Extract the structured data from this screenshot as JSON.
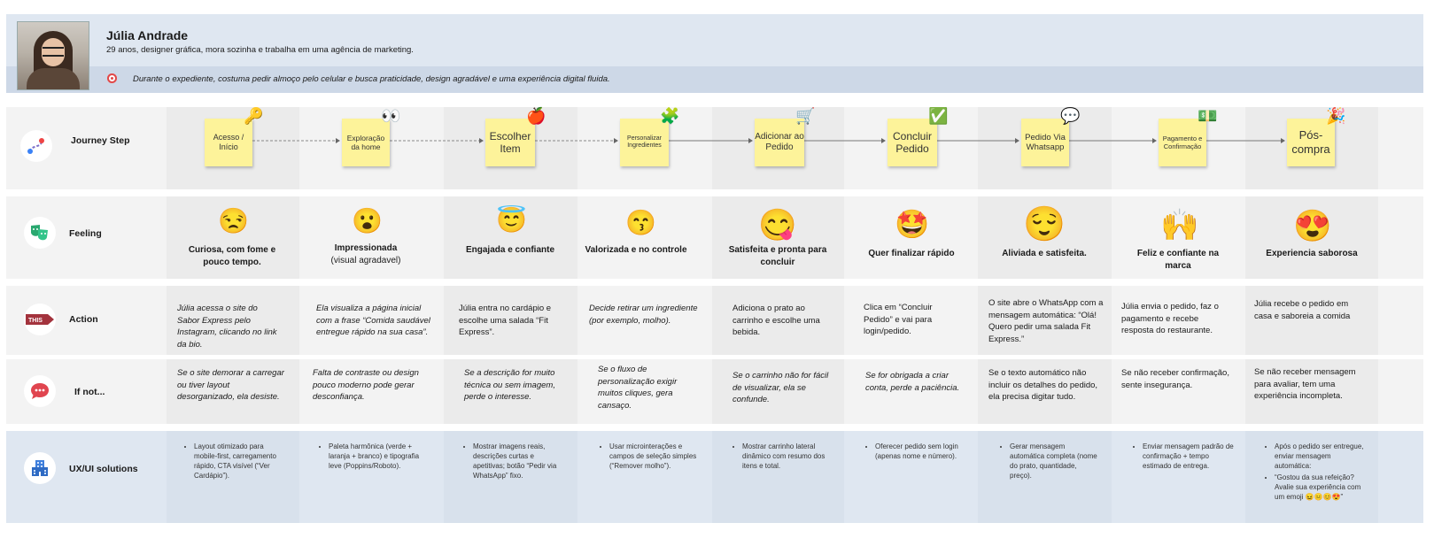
{
  "persona": {
    "name": "Júlia Andrade",
    "description": "29 anos, designer gráfica, mora sozinha e trabalha em uma agência de marketing.",
    "goal": "Durante o expediente, costuma pedir almoço pelo celular e busca praticidade, design agradável e uma experiência digital fluida."
  },
  "rows": {
    "journey": {
      "label": "Journey Step",
      "icon": "route-icon"
    },
    "feeling": {
      "label": "Feeling",
      "icon": "theater-masks-icon"
    },
    "action": {
      "label": "Action",
      "icon": "this-way-sign-icon",
      "icon_text": "THIS"
    },
    "ifnot": {
      "label": "If not...",
      "icon": "speech-bubble-icon"
    },
    "ux": {
      "label": "UX/UI solutions",
      "icon": "building-icon"
    }
  },
  "steps": [
    {
      "title": "Acesso / Início",
      "deco": "key-icon"
    },
    {
      "title": "Exploração da home",
      "deco": "eyes-icon"
    },
    {
      "title": "Escolher Item",
      "deco": "apple-icon"
    },
    {
      "title": "Personalizar Ingredientes",
      "deco": "puzzle-icon"
    },
    {
      "title": "Adicionar ao Pedido",
      "deco": "cart-icon"
    },
    {
      "title": "Concluir Pedido",
      "deco": "checkmark-icon"
    },
    {
      "title": "Pedido Via Whatsapp",
      "deco": "chat-bubble-icon"
    },
    {
      "title": "Pagamento e Confirmação",
      "deco": "money-icon"
    },
    {
      "title": "Pós-compra",
      "deco": "party-popper-icon"
    }
  ],
  "feelings": [
    {
      "label": "Curiosa, com fome e pouco tempo.",
      "sub": "",
      "emoji": "unamused-face-icon"
    },
    {
      "label": "Impressionada",
      "sub": "(visual agradavel)",
      "emoji": "surprised-face-icon"
    },
    {
      "label": "Engajada e confiante",
      "sub": "",
      "emoji": "halo-smile-face-icon"
    },
    {
      "label": "Valorizada e no controle",
      "sub": "",
      "emoji": "kissing-wink-face-icon"
    },
    {
      "label": "Satisfeita e pronta para concluir",
      "sub": "",
      "emoji": "yum-face-icon"
    },
    {
      "label": "Quer finalizar rápido",
      "sub": "",
      "emoji": "star-struck-face-icon"
    },
    {
      "label": "Aliviada e satisfeita.",
      "sub": "",
      "emoji": "relieved-face-icon"
    },
    {
      "label": "Feliz e confiante na marca",
      "sub": "",
      "emoji": "raising-hands-icon"
    },
    {
      "label": "Experiencia saborosa",
      "sub": "",
      "emoji": "heart-eyes-face-icon"
    }
  ],
  "actions": [
    {
      "text": "Júlia acessa o site do Sabor Express pelo Instagram, clicando no link da bio.",
      "italic": true
    },
    {
      "text": "Ela visualiza a página inicial com a frase “Comida saudável entregue rápido na sua casa”.",
      "italic": true
    },
    {
      "text": "Júlia entra no cardápio e escolhe uma salada “Fit Express”.",
      "italic": false
    },
    {
      "text": "Decide retirar um ingrediente (por exemplo, molho).",
      "italic": true
    },
    {
      "text": "Adiciona o prato ao carrinho e escolhe uma bebida.",
      "italic": false
    },
    {
      "text": "Clica em “Concluir Pedido” e vai para login/pedido.",
      "italic": false
    },
    {
      "text": "O site abre o WhatsApp com a mensagem automática: “Olá! Quero pedir uma salada Fit Express.”",
      "italic": false
    },
    {
      "text": "Júlia envia o pedido, faz o pagamento e recebe resposta do restaurante.",
      "italic": false
    },
    {
      "text": "Júlia recebe o pedido em casa e saboreia a comida",
      "italic": false
    }
  ],
  "ifnot": [
    {
      "text": "Se o site demorar a carregar ou tiver layout desorganizado, ela desiste.",
      "italic": true
    },
    {
      "text": "Falta de contraste ou design pouco moderno pode gerar desconfiança.",
      "italic": true
    },
    {
      "text": "Se a descrição for muito técnica ou sem imagem, perde o interesse.",
      "italic": true
    },
    {
      "text": "Se o fluxo de personalização exigir muitos cliques, gera cansaço.",
      "italic": true
    },
    {
      "text": "Se o carrinho não for fácil de visualizar, ela se confunde.",
      "italic": true
    },
    {
      "text": "Se for obrigada a criar conta, perde a paciência.",
      "italic": true
    },
    {
      "text": "Se o texto automático não incluir os detalhes do pedido, ela precisa digitar tudo.",
      "italic": false
    },
    {
      "text": "Se não receber confirmação, sente insegurança.",
      "italic": false
    },
    {
      "text": "Se não receber mensagem para avaliar, tem uma experiência incompleta.",
      "italic": false
    }
  ],
  "ux": [
    [
      "Layout otimizado para mobile-first, carregamento rápido, CTA visível (“Ver Cardápio”)."
    ],
    [
      "Paleta harmônica (verde + laranja + branco) e tipografia leve (Poppins/Roboto)."
    ],
    [
      "Mostrar imagens reais, descrições curtas e apetitivas; botão “Pedir via WhatsApp” fixo."
    ],
    [
      "Usar microinterações e campos de seleção simples (“Remover molho”)."
    ],
    [
      "Mostrar carrinho lateral dinâmico com resumo dos itens e total."
    ],
    [
      "Oferecer pedido sem login (apenas nome e número)."
    ],
    [
      "Gerar mensagem automática completa (nome do prato, quantidade, preço)."
    ],
    [
      "Enviar mensagem padrão de confirmação + tempo estimado de entrega."
    ],
    [
      "Após o pedido ser entregue, enviar mensagem automática:",
      "“Gostou da sua refeição? Avalie sua experiência com um emoji 😖😐😊😍”"
    ]
  ],
  "colors": {
    "sticky": "#fdf39a",
    "persona_bg": "#dfe7f1",
    "goal_bg": "#cdd8e7",
    "ux_bg": "#dfe7f1",
    "grey_band": "#f3f3f3",
    "alt_column": "#ebebeb"
  }
}
